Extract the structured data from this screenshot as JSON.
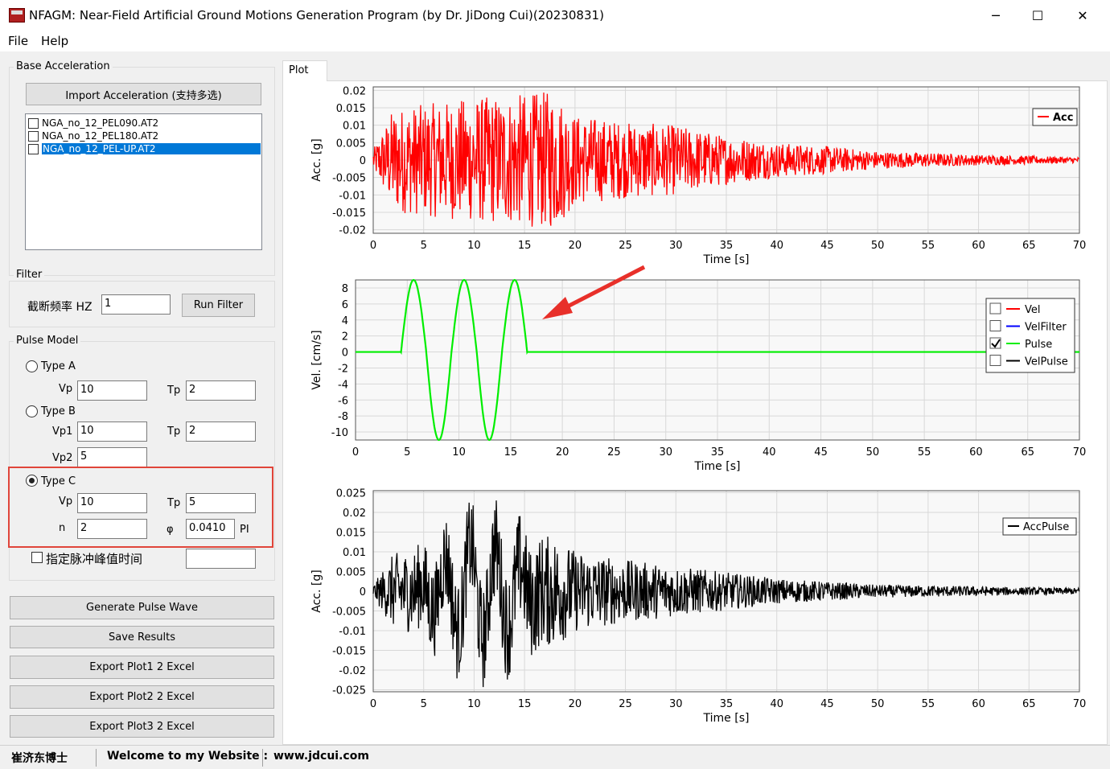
{
  "window": {
    "title": "NFAGM: Near-Field Artificial Ground Motions Generation Program (by Dr. JiDong Cui)(20230831)",
    "minimize_glyph": "─",
    "maximize_glyph": "☐",
    "close_glyph": "✕"
  },
  "menu": [
    "File",
    "Help"
  ],
  "base_acceleration": {
    "label": "Base Acceleration",
    "import_button": "Import Acceleration (支持多选)",
    "files": [
      {
        "name": "NGA_no_12_PEL090.AT2",
        "checked": false,
        "selected": false
      },
      {
        "name": "NGA_no_12_PEL180.AT2",
        "checked": false,
        "selected": false
      },
      {
        "name": "NGA_no_12_PEL-UP.AT2",
        "checked": false,
        "selected": true
      }
    ]
  },
  "filter": {
    "label": "Filter",
    "cutoff_label": "截断频率 HZ",
    "cutoff_value": "1",
    "run_button": "Run Filter"
  },
  "pulse_model": {
    "label": "Pulse Model",
    "type_a": {
      "label": "Type A",
      "selected": false,
      "vp_label": "Vp",
      "vp": "10",
      "tp_label": "Tp",
      "tp": "2"
    },
    "type_b": {
      "label": "Type B",
      "selected": false,
      "vp1_label": "Vp1",
      "vp1": "10",
      "tp_label": "Tp",
      "tp": "2",
      "vp2_label": "Vp2",
      "vp2": "5"
    },
    "type_c": {
      "label": "Type C",
      "selected": true,
      "vp_label": "Vp",
      "vp": "10",
      "tp_label": "Tp",
      "tp": "5",
      "n_label": "n",
      "n": "2",
      "phi_label": "φ",
      "phi": "0.0410",
      "phi_unit": "PI"
    },
    "peak_time_label": "指定脉冲峰值时间",
    "peak_time_checked": false,
    "peak_time_value": ""
  },
  "actions": {
    "generate": "Generate Pulse Wave",
    "save": "Save Results",
    "export1": "Export Plot1 2 Excel",
    "export2": "Export Plot2 2 Excel",
    "export3": "Export Plot3 2 Excel"
  },
  "tab": {
    "label": "Plot"
  },
  "status": {
    "author": "崔济东博士",
    "welcome": "Welcome to my Website :",
    "website": "www.jdcui.com"
  },
  "chart_data": [
    {
      "type": "line",
      "xlabel": "Time [s]",
      "ylabel": "Acc. [g]",
      "xlim": [
        0,
        70
      ],
      "ylim": [
        -0.021,
        0.021
      ],
      "xticks": [
        "0",
        "5",
        "10",
        "15",
        "20",
        "25",
        "30",
        "35",
        "40",
        "45",
        "50",
        "55",
        "60",
        "65",
        "70"
      ],
      "yticks": [
        "0.02",
        "0.015",
        "0.01",
        "0.005",
        "0",
        "-0.005",
        "-0.01",
        "-0.015",
        "-0.02"
      ],
      "grid": true,
      "legend_position": "top-right",
      "series": [
        {
          "name": "Acc",
          "color": "#ff0000",
          "envelope_t": [
            0,
            2,
            5,
            10,
            15,
            18,
            20,
            25,
            30,
            35,
            40,
            45,
            50,
            55,
            60,
            65,
            70
          ],
          "envelope_amp": [
            0.003,
            0.015,
            0.016,
            0.018,
            0.019,
            0.02,
            0.013,
            0.011,
            0.01,
            0.007,
            0.005,
            0.004,
            0.0025,
            0.002,
            0.0015,
            0.0012,
            0.0008
          ]
        }
      ]
    },
    {
      "type": "line",
      "xlabel": "Time [s]",
      "ylabel": "Vel. [cm/s]",
      "xlim": [
        0,
        70
      ],
      "ylim": [
        -11,
        9
      ],
      "xticks": [
        "0",
        "5",
        "10",
        "15",
        "20",
        "25",
        "30",
        "35",
        "40",
        "45",
        "50",
        "55",
        "60",
        "65",
        "70"
      ],
      "yticks": [
        "8",
        "6",
        "4",
        "2",
        "0",
        "-2",
        "-4",
        "-6",
        "-8",
        "-10"
      ],
      "grid": true,
      "legend_position": "top-right",
      "series": [
        {
          "name": "Vel",
          "color": "#ff0000",
          "checked": false
        },
        {
          "name": "VelFilter",
          "color": "#0000ff",
          "checked": false
        },
        {
          "name": "Pulse",
          "color": "#00ee00",
          "checked": true,
          "pulse_start": 4.4,
          "pulse_end": 16.6,
          "amplitude_peaks": [
            9.0,
            -11.0,
            9.0,
            -11.0,
            9.0
          ]
        },
        {
          "name": "VelPulse",
          "color": "#000000",
          "checked": false
        }
      ]
    },
    {
      "type": "line",
      "xlabel": "Time [s]",
      "ylabel": "Acc. [g]",
      "xlim": [
        0,
        70
      ],
      "ylim": [
        -0.0255,
        0.0255
      ],
      "xticks": [
        "0",
        "5",
        "10",
        "15",
        "20",
        "25",
        "30",
        "35",
        "40",
        "45",
        "50",
        "55",
        "60",
        "65",
        "70"
      ],
      "yticks": [
        "0.025",
        "0.02",
        "0.015",
        "0.01",
        "0.005",
        "0",
        "-0.005",
        "-0.01",
        "-0.015",
        "-0.02",
        "-0.025"
      ],
      "grid": true,
      "legend_position": "top-right",
      "series": [
        {
          "name": "AccPulse",
          "color": "#000000",
          "envelope_t": [
            0,
            2,
            5,
            10,
            15,
            18,
            20,
            25,
            30,
            35,
            40,
            45,
            50,
            55,
            60,
            65,
            70
          ],
          "envelope_amp": [
            0.002,
            0.012,
            0.014,
            0.016,
            0.017,
            0.018,
            0.013,
            0.01,
            0.008,
            0.006,
            0.004,
            0.003,
            0.002,
            0.0018,
            0.0015,
            0.0012,
            0.001
          ]
        }
      ]
    }
  ],
  "annotation": {
    "arrow_color": "#e8302a"
  }
}
